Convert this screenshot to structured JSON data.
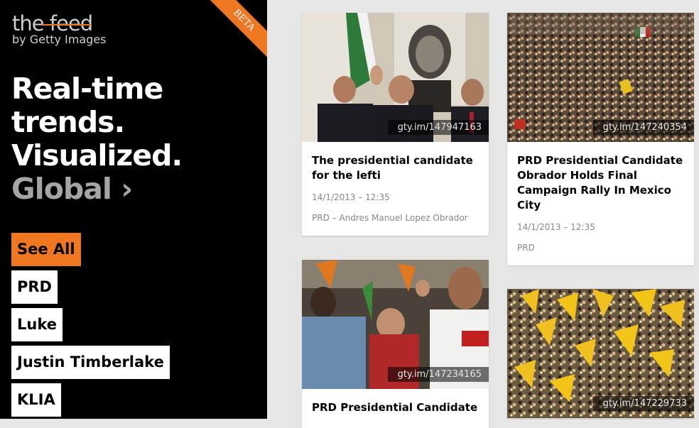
{
  "logo": {
    "main": "the feed",
    "sub": "by Getty Images",
    "badge": "BETA"
  },
  "headline": {
    "line1": "Real-time",
    "line2": "trends.",
    "line3": "Visualized.",
    "line4": "Global",
    "chevron": "›"
  },
  "tags": [
    {
      "label": "See All"
    },
    {
      "label": "PRD"
    },
    {
      "label": "Luke"
    },
    {
      "label": "Justin Timberlake"
    },
    {
      "label": "KLIA"
    }
  ],
  "cards": [
    {
      "link": "gty.im/147947163",
      "title": "The presidential candidate for the lefti",
      "date": "14/1/2013 – 12:35",
      "tag": "PRD – Andres Manuel Lopez Obrador"
    },
    {
      "link": "gty.im/147240354",
      "title": "PRD Presidential Candidate Obrador Holds Final Campaign Rally In Mexico City",
      "date": "14/1/2013 – 12:35",
      "tag": "PRD"
    },
    {
      "link": "gty.im/147234165",
      "title": "PRD Presidential Candidate",
      "date": "",
      "tag": ""
    },
    {
      "link": "gty.im/147229733",
      "title": "",
      "date": "",
      "tag": ""
    }
  ],
  "colors": {
    "accent": "#f07722",
    "sidebar": "#000000",
    "background": "#e6e6e6"
  }
}
